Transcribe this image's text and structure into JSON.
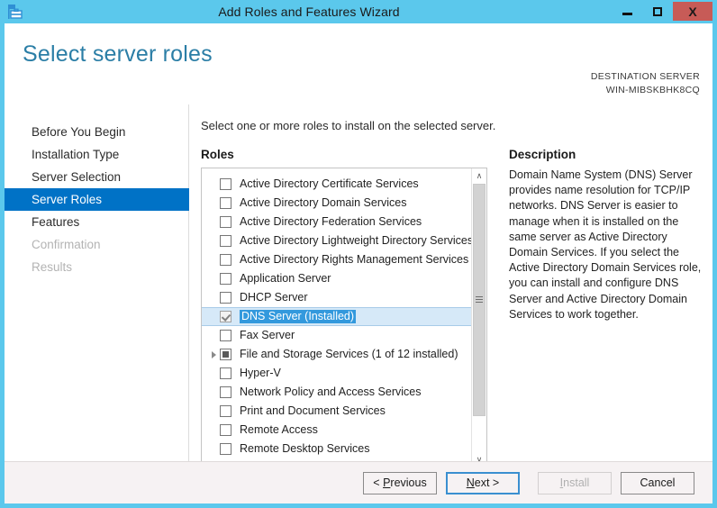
{
  "window": {
    "title": "Add Roles and Features Wizard",
    "icon": "server-manager-icon",
    "minimize_label": "Minimize",
    "maximize_label": "Maximize",
    "close_label": "X",
    "titlebar_color": "#5bc8ec",
    "close_button_color": "#c75b57"
  },
  "header": {
    "page_title": "Select server roles",
    "destination_label": "DESTINATION SERVER",
    "destination_name": "WIN-MIBSKBHK8CQ",
    "title_color": "#2b7ea6"
  },
  "sidebar": {
    "accent_color": "#0072c6",
    "items": [
      {
        "label": "Before You Begin",
        "state": "normal"
      },
      {
        "label": "Installation Type",
        "state": "normal"
      },
      {
        "label": "Server Selection",
        "state": "normal"
      },
      {
        "label": "Server Roles",
        "state": "active"
      },
      {
        "label": "Features",
        "state": "normal"
      },
      {
        "label": "Confirmation",
        "state": "disabled"
      },
      {
        "label": "Results",
        "state": "disabled"
      }
    ]
  },
  "main": {
    "instruction": "Select one or more roles to install on the selected server.",
    "roles_label": "Roles",
    "description_label": "Description",
    "description_text": "Domain Name System (DNS) Server provides name resolution for TCP/IP networks. DNS Server is easier to manage when it is installed on the same server as Active Directory Domain Services. If you select the Active Directory Domain Services role, you can install and configure DNS Server and Active Directory Domain Services to work together.",
    "selection_highlight_color": "#3399dd",
    "row_highlight_color": "#d6e9f8",
    "roles": [
      {
        "label": "Active Directory Certificate Services",
        "checkbox": "unchecked",
        "expandable": false,
        "selected": false
      },
      {
        "label": "Active Directory Domain Services",
        "checkbox": "unchecked",
        "expandable": false,
        "selected": false
      },
      {
        "label": "Active Directory Federation Services",
        "checkbox": "unchecked",
        "expandable": false,
        "selected": false
      },
      {
        "label": "Active Directory Lightweight Directory Services",
        "checkbox": "unchecked",
        "expandable": false,
        "selected": false
      },
      {
        "label": "Active Directory Rights Management Services",
        "checkbox": "unchecked",
        "expandable": false,
        "selected": false
      },
      {
        "label": "Application Server",
        "checkbox": "unchecked",
        "expandable": false,
        "selected": false
      },
      {
        "label": "DHCP Server",
        "checkbox": "unchecked",
        "expandable": false,
        "selected": false
      },
      {
        "label": "DNS Server (Installed)",
        "checkbox": "checked-disabled",
        "expandable": false,
        "selected": true
      },
      {
        "label": "Fax Server",
        "checkbox": "unchecked",
        "expandable": false,
        "selected": false
      },
      {
        "label": "File and Storage Services (1 of 12 installed)",
        "checkbox": "partial",
        "expandable": true,
        "selected": false
      },
      {
        "label": "Hyper-V",
        "checkbox": "unchecked",
        "expandable": false,
        "selected": false
      },
      {
        "label": "Network Policy and Access Services",
        "checkbox": "unchecked",
        "expandable": false,
        "selected": false
      },
      {
        "label": "Print and Document Services",
        "checkbox": "unchecked",
        "expandable": false,
        "selected": false
      },
      {
        "label": "Remote Access",
        "checkbox": "unchecked",
        "expandable": false,
        "selected": false
      },
      {
        "label": "Remote Desktop Services",
        "checkbox": "unchecked",
        "expandable": false,
        "selected": false
      }
    ],
    "scrollbar": {
      "up_glyph": "∧",
      "down_glyph": "∨"
    }
  },
  "footer": {
    "previous": {
      "pre": "< ",
      "accel": "P",
      "post": "revious",
      "state": "enabled"
    },
    "next": {
      "pre": "",
      "accel": "N",
      "post": "ext >",
      "state": "default"
    },
    "install": {
      "pre": "",
      "accel": "I",
      "post": "nstall",
      "state": "disabled"
    },
    "cancel": {
      "pre": "",
      "accel": "",
      "post": "Cancel",
      "state": "enabled"
    }
  }
}
